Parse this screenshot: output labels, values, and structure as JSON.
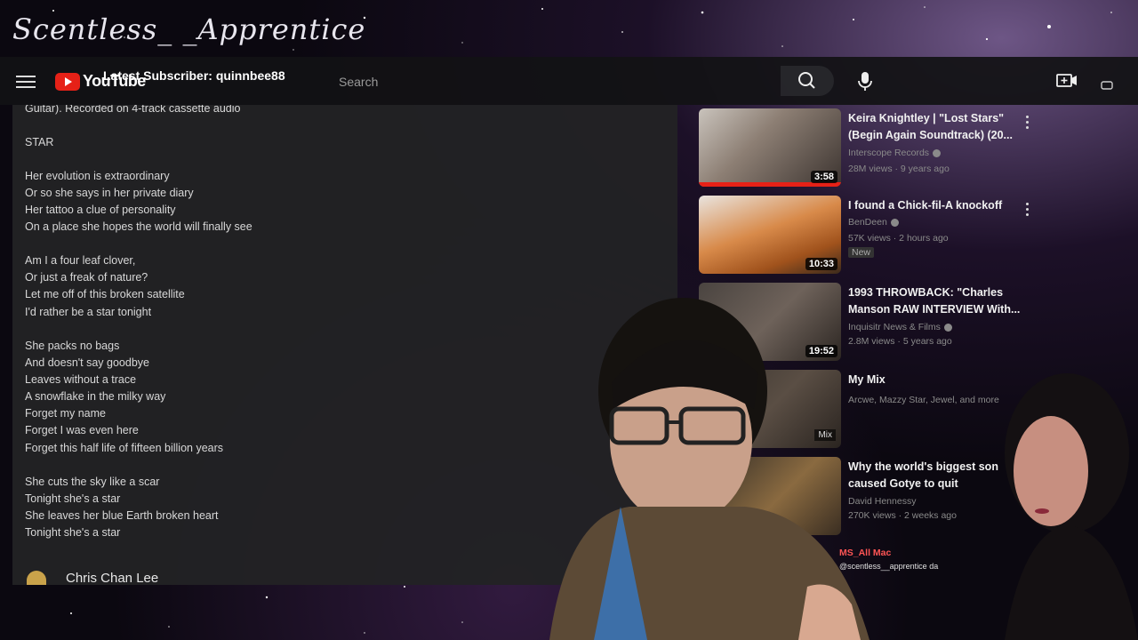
{
  "overlay": {
    "title": "Scentless_ _Apprentice",
    "latest_subscriber": "Latest Subscriber: quinnbee88"
  },
  "topbar": {
    "menu_icon": "hamburger-menu-icon",
    "logo_text": "YouTube",
    "search_placeholder": "Search",
    "search_icon": "search-icon",
    "mic_icon": "microphone-icon",
    "create_icon": "create-video-icon"
  },
  "description": {
    "lines": [
      "Guitar). Recorded on 4-track cassette audio",
      "STAR",
      "Her evolution is extraordinary",
      "Or so she says in her private diary",
      "Her tattoo a clue of personality",
      "On a place she hopes the world will finally see",
      "Am I a four leaf clover,",
      "Or just a freak of nature?",
      "Let me off of this broken satellite",
      "I'd rather be a star tonight",
      "She packs no bags",
      "And doesn't say goodbye",
      "Leaves without a trace",
      "A snowflake in the milky way",
      "Forget my name",
      "Forget I was even here",
      "Forget this half life of fifteen billion years",
      "She cuts the sky like a scar",
      "Tonight she's a star",
      "She leaves her blue Earth broken heart",
      "Tonight she's a star"
    ]
  },
  "comment": {
    "author": "Chris Chan Lee"
  },
  "related": [
    {
      "title": "Keira Knightley | \"Lost Stars\" (Begin Again Soundtrack) (20...",
      "channel": "Interscope Records",
      "stats": "28M views · 9 years ago",
      "duration": "3:58"
    },
    {
      "title": "I found a Chick-fil-A knockoff",
      "channel": "BenDeen",
      "stats": "57K views · 2 hours ago",
      "badge": "New",
      "duration": "10:33"
    },
    {
      "title": "1993 THROWBACK: \"Charles Manson RAW INTERVIEW With...",
      "channel": "Inquisitr News & Films",
      "stats": "2.8M views · 5 years ago",
      "duration": "19:52"
    },
    {
      "title": "My Mix",
      "channel": "Arcwe, Mazzy Star, Jewel, and more",
      "stats": "",
      "duration": "Mix"
    },
    {
      "title": "Why the world's biggest son caused Gotye to quit",
      "channel": "David Hennessy",
      "stats": "270K views · 2 weeks ago",
      "duration": ""
    }
  ],
  "chat": {
    "name": "MS_All Mac",
    "message": "@scentless__apprentice da"
  },
  "colors": {
    "youtube_red": "#e62117",
    "panel_bg": "#222224",
    "topbar_bg": "#121214"
  }
}
